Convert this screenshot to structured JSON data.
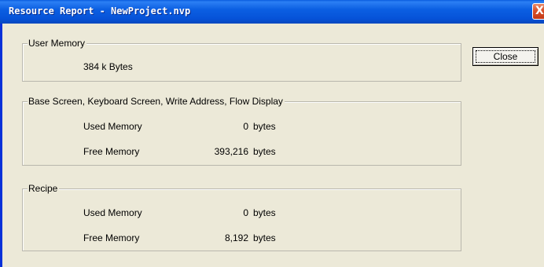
{
  "window": {
    "title": "Resource Report - NewProject.nvp",
    "close_glyph": "X"
  },
  "user_memory": {
    "label": "User Memory",
    "value": "384 k Bytes"
  },
  "base_screen": {
    "label": "Base Screen, Keyboard Screen, Write Address, Flow Display",
    "used_label": "Used Memory",
    "used_value": "0",
    "used_unit": "bytes",
    "free_label": "Free Memory",
    "free_value": "393,216",
    "free_unit": "bytes"
  },
  "recipe": {
    "label": "Recipe",
    "used_label": "Used Memory",
    "used_value": "0",
    "used_unit": "bytes",
    "free_label": "Free Memory",
    "free_value": "8,192",
    "free_unit": "bytes"
  },
  "buttons": {
    "close_label": "Close"
  },
  "icons": {
    "window_close": "close-icon"
  },
  "colors": {
    "titlebar": "#0652d8",
    "window_bg": "#ece9d8",
    "close_button": "#d9502a"
  }
}
